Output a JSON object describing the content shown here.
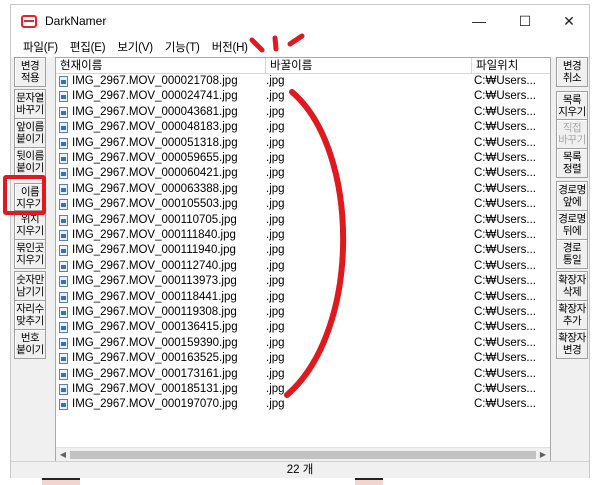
{
  "window": {
    "title": "DarkNamer"
  },
  "controls": {
    "minimize": "—",
    "maximize": "☐",
    "close": "✕"
  },
  "menu": [
    "파일(F)",
    "편집(E)",
    "보기(V)",
    "기능(T)",
    "버전(H)"
  ],
  "left_buttons": [
    {
      "label": "변경\n적용"
    },
    {
      "label": "문자열\n바꾸기"
    },
    {
      "label": "앞이름\n붙이기"
    },
    {
      "label": "뒷이름\n붙이기"
    },
    {
      "label": "이름\n지우기"
    },
    {
      "label": "위치\n지우기"
    },
    {
      "label": "묶인곳\n지우기"
    },
    {
      "label": "숫자만\n남기기"
    },
    {
      "label": "자리수\n맞추기"
    },
    {
      "label": "번호\n붙이기"
    }
  ],
  "right_buttons": [
    {
      "label": "변경\n취소",
      "disabled": false
    },
    {
      "label": "목록\n지우기",
      "disabled": false
    },
    {
      "label": "직접\n바꾸기",
      "disabled": true
    },
    {
      "label": "목록\n정렬",
      "disabled": false
    },
    {
      "label": "경로명\n앞에",
      "disabled": false
    },
    {
      "label": "경로명\n뒤에",
      "disabled": false
    },
    {
      "label": "경로\n통일",
      "disabled": false
    },
    {
      "label": "확장자\n삭제",
      "disabled": false
    },
    {
      "label": "확장자\n추가",
      "disabled": false
    },
    {
      "label": "확장자\n변경",
      "disabled": false
    }
  ],
  "list": {
    "columns": [
      "현재이름",
      "바꿀이름",
      "파일위치"
    ],
    "rows": [
      {
        "name": "IMG_2967.MOV_000021708.jpg",
        "new": ".jpg",
        "path": "C:₩Users..."
      },
      {
        "name": "IMG_2967.MOV_000024741.jpg",
        "new": ".jpg",
        "path": "C:₩Users..."
      },
      {
        "name": "IMG_2967.MOV_000043681.jpg",
        "new": ".jpg",
        "path": "C:₩Users..."
      },
      {
        "name": "IMG_2967.MOV_000048183.jpg",
        "new": ".jpg",
        "path": "C:₩Users..."
      },
      {
        "name": "IMG_2967.MOV_000051318.jpg",
        "new": ".jpg",
        "path": "C:₩Users..."
      },
      {
        "name": "IMG_2967.MOV_000059655.jpg",
        "new": ".jpg",
        "path": "C:₩Users..."
      },
      {
        "name": "IMG_2967.MOV_000060421.jpg",
        "new": ".jpg",
        "path": "C:₩Users..."
      },
      {
        "name": "IMG_2967.MOV_000063388.jpg",
        "new": ".jpg",
        "path": "C:₩Users..."
      },
      {
        "name": "IMG_2967.MOV_000105503.jpg",
        "new": ".jpg",
        "path": "C:₩Users..."
      },
      {
        "name": "IMG_2967.MOV_000110705.jpg",
        "new": ".jpg",
        "path": "C:₩Users..."
      },
      {
        "name": "IMG_2967.MOV_000111840.jpg",
        "new": ".jpg",
        "path": "C:₩Users..."
      },
      {
        "name": "IMG_2967.MOV_000111940.jpg",
        "new": ".jpg",
        "path": "C:₩Users..."
      },
      {
        "name": "IMG_2967.MOV_000112740.jpg",
        "new": ".jpg",
        "path": "C:₩Users..."
      },
      {
        "name": "IMG_2967.MOV_000113973.jpg",
        "new": ".jpg",
        "path": "C:₩Users..."
      },
      {
        "name": "IMG_2967.MOV_000118441.jpg",
        "new": ".jpg",
        "path": "C:₩Users..."
      },
      {
        "name": "IMG_2967.MOV_000119308.jpg",
        "new": ".jpg",
        "path": "C:₩Users..."
      },
      {
        "name": "IMG_2967.MOV_000136415.jpg",
        "new": ".jpg",
        "path": "C:₩Users..."
      },
      {
        "name": "IMG_2967.MOV_000159390.jpg",
        "new": ".jpg",
        "path": "C:₩Users..."
      },
      {
        "name": "IMG_2967.MOV_000163525.jpg",
        "new": ".jpg",
        "path": "C:₩Users..."
      },
      {
        "name": "IMG_2967.MOV_000173161.jpg",
        "new": ".jpg",
        "path": "C:₩Users..."
      },
      {
        "name": "IMG_2967.MOV_000185131.jpg",
        "new": ".jpg",
        "path": "C:₩Users..."
      },
      {
        "name": "IMG_2967.MOV_000197070.jpg",
        "new": ".jpg",
        "path": "C:₩Users..."
      }
    ]
  },
  "status": {
    "count": "22 개"
  },
  "annotation": {
    "color": "#e0191f"
  }
}
